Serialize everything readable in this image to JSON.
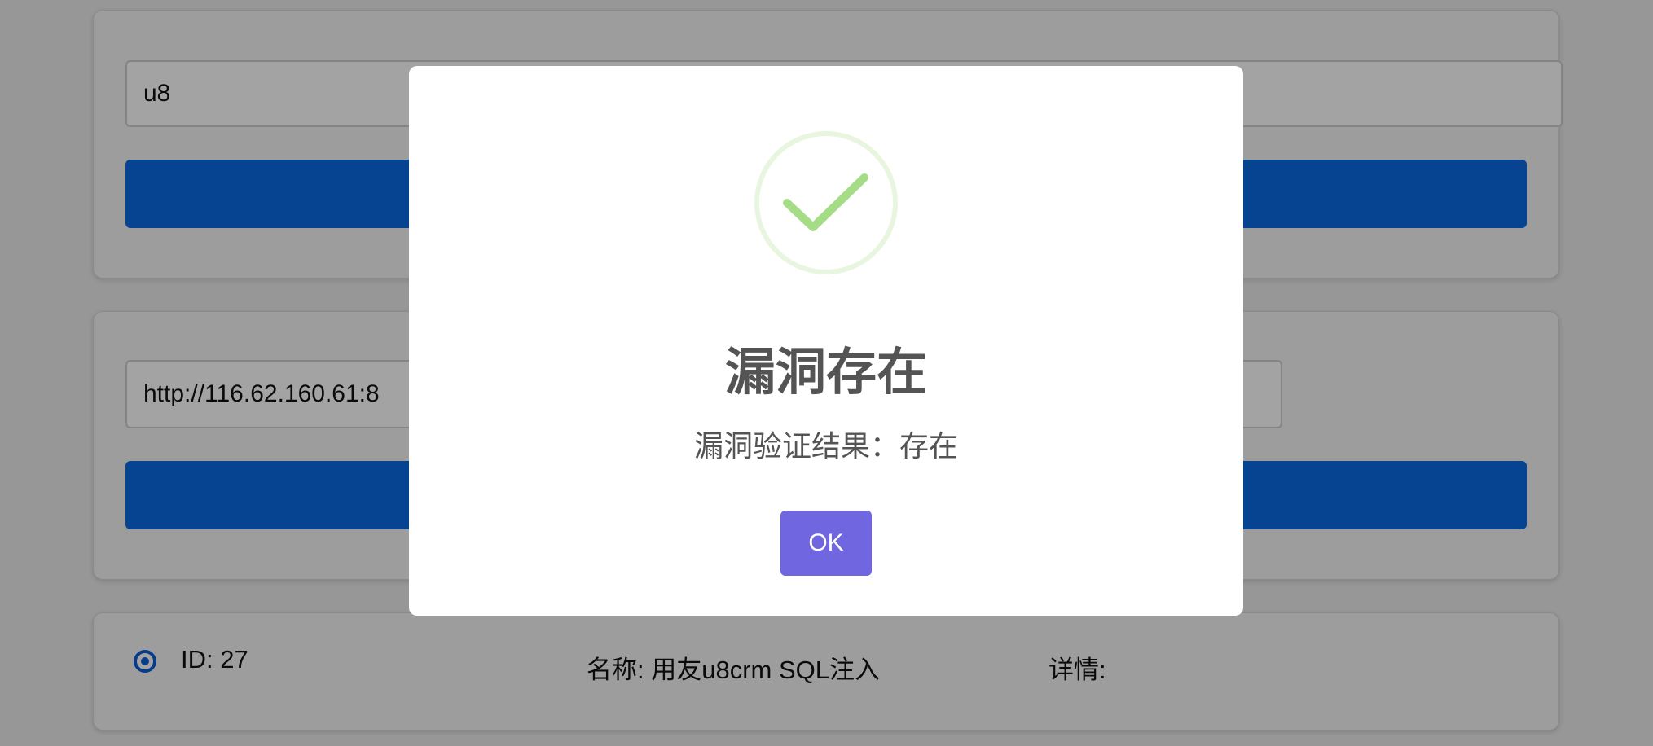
{
  "search": {
    "keyword_value": "u8"
  },
  "verify": {
    "url_value": "http://116.62.160.61:8"
  },
  "vuln_item": {
    "id_text": "ID: 27",
    "name_text": "名称: 用友u8crm SQL注入",
    "detail_text": "详情:"
  },
  "modal": {
    "icon": "success-check-icon",
    "title": "漏洞存在",
    "text": "漏洞验证结果：存在",
    "ok_label": "OK"
  },
  "colors": {
    "primary_button": "#0a6ae3",
    "ok_button": "#7066e0",
    "success_icon": "#a5dc86"
  }
}
